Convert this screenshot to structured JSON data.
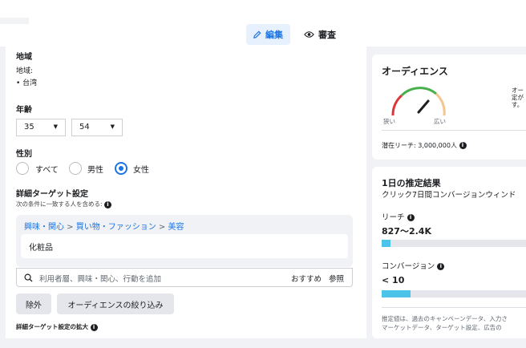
{
  "header": {
    "tab_edit": "編集",
    "tab_review": "審査"
  },
  "location": {
    "heading": "地域",
    "label": "地域:",
    "value": "• 台湾"
  },
  "age": {
    "heading": "年齢",
    "min": "35",
    "max": "54"
  },
  "gender": {
    "heading": "性別",
    "options": [
      "すべて",
      "男性",
      "女性"
    ],
    "selected": "女性"
  },
  "detailed_targeting": {
    "heading": "詳細ターゲット設定",
    "subtext": "次の条件に一致する人を含める:",
    "breadcrumb": [
      "興味・関心",
      "買い物・ファッション",
      "美容"
    ],
    "selected_item": "化粧品",
    "search_placeholder": "利用者層、興味・関心、行動を追加",
    "suggest_label": "おすすめ",
    "browse_label": "参照",
    "exclude_button": "除外",
    "narrow_button": "オーディエンスの絞り込み",
    "expansion_label": "詳細ターゲット設定の拡大"
  },
  "audience": {
    "title": "オーディエンス",
    "gauge_narrow": "狭い",
    "gauge_broad": "広い",
    "gauge_level": 0.55,
    "side_text": [
      "オー",
      "定が",
      "す。"
    ],
    "potential_reach": "潜在リーチ: 3,000,000人"
  },
  "daily_results": {
    "title": "1日の推定結果",
    "subtitle": "クリック7日間コンバージョンウィンド",
    "reach_label": "リーチ",
    "reach_value": "827〜2.4K",
    "reach_fill": 0.06,
    "conversion_label": "コンバージョン",
    "conversion_value": "< 10",
    "conversion_fill": 0.2,
    "footnote_1": "推定値は、過去のキャンペーンデータ、入力さ",
    "footnote_2": "マーケットデータ、ターゲット設定、広告の"
  },
  "colors": {
    "accent": "#1b74e4",
    "bar": "#4cc3e8"
  }
}
